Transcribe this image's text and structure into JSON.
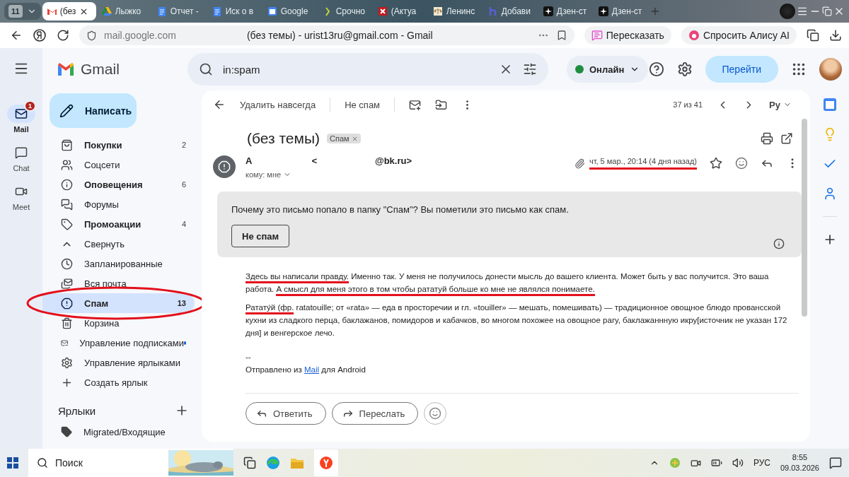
{
  "browser": {
    "tab_count": "11",
    "tabs": [
      {
        "title": "(без",
        "selected": true
      },
      {
        "title": "Лыжко",
        "selected": false
      },
      {
        "title": "Отчет -",
        "selected": false
      },
      {
        "title": "Иск о в",
        "selected": false
      },
      {
        "title": "Google",
        "selected": false
      },
      {
        "title": "Срочно",
        "selected": false
      },
      {
        "title": "(Актуа",
        "selected": false
      },
      {
        "title": "Ленинс",
        "selected": false
      },
      {
        "title": "Добави",
        "selected": false
      },
      {
        "title": "Дзен-ст",
        "selected": false
      },
      {
        "title": "Дзен-ст",
        "selected": false
      }
    ],
    "address": "mail.google.com",
    "page_title": "(без темы) - urist13ru@gmail.com - Gmail",
    "retell_button": "Пересказать",
    "alice_button": "Спросить Алису AI"
  },
  "rail": {
    "items": [
      {
        "label": "Mail",
        "badge": "1",
        "selected": true
      },
      {
        "label": "Chat",
        "selected": false
      },
      {
        "label": "Meet",
        "selected": false
      }
    ]
  },
  "header": {
    "logo": "Gmail",
    "search": "in:spam",
    "status": "Онлайн",
    "go_button": "Перейти"
  },
  "compose": "Написать",
  "sidebar": {
    "items": [
      {
        "label": "Покупки",
        "count": "2",
        "bold": true,
        "selected": false
      },
      {
        "label": "Соцсети",
        "bold": false,
        "selected": false
      },
      {
        "label": "Оповещения",
        "count": "6",
        "bold": true,
        "selected": false
      },
      {
        "label": "Форумы",
        "bold": false,
        "selected": false
      },
      {
        "label": "Промоакции",
        "count": "4",
        "bold": true,
        "selected": false
      },
      {
        "label": "Свернуть",
        "bold": false,
        "selected": false
      },
      {
        "label": "Запланированные",
        "bold": false,
        "selected": false
      },
      {
        "label": "Вся почта",
        "bold": false,
        "selected": false
      },
      {
        "label": "Спам",
        "count": "13",
        "bold": true,
        "selected": true,
        "circled": true
      },
      {
        "label": "Корзина",
        "bold": false,
        "selected": false
      },
      {
        "label": "Управление подписками",
        "bold": false,
        "selected": false,
        "dot": true
      },
      {
        "label": "Управление ярлыками",
        "bold": false,
        "selected": false
      },
      {
        "label": "Создать ярлык",
        "bold": false,
        "selected": false
      }
    ],
    "labels_heading": "Ярлыки",
    "labels": [
      "Migrated/Входящие"
    ]
  },
  "toolbar": {
    "delete_forever": "Удалить навсегда",
    "not_spam": "Не спам",
    "position": "37 из 41",
    "input_tool": "Ру"
  },
  "message": {
    "subject": "(без темы)",
    "label": "Спам",
    "sender_name": "A",
    "sender_open": "<",
    "sender_domain": "@bk.ru>",
    "recipient": "кому: мне",
    "date": "чт, 5 мар., 20:14 (4 дня назад)",
    "date_marked": true,
    "banner": {
      "text": "Почему это письмо попало в папку \"Спам\"? Вы пометили это письмо как спам.",
      "button": "Не спам"
    },
    "paragraphs": [
      {
        "segments": [
          {
            "text": "Здесь вы написали правду.",
            "marked": true
          },
          {
            "text": " Именно так. У меня не получилось донести мысль до вашего клиента. Может быть у вас получится. Это ваша работа. ",
            "marked": false
          },
          {
            "text": "А смысл для меня этого в том чтобы рататуй больше ко мне не являлся понимаете.",
            "marked": true
          }
        ]
      },
      {
        "segments": [
          {
            "text": "Ратату́й (фр.",
            "marked": true
          },
          {
            "text": " ratatouille; от «rata» — еда в просторечии и гл. «touiller» — мешать, помешивать) — традиционное овощное блюдо провансской кухни из сладкого перца, баклажанов, помидоров и кабачков, во многом похожее на овощное рагу, баклажаннную икру[источник не указан 172 дня] и венгерское лечо.",
            "marked": false
          }
        ]
      }
    ],
    "signature": {
      "dash": "--",
      "before": "Отправлено из",
      "link": "Mail",
      "after": "для Android"
    },
    "reply_button": "Ответить",
    "forward_button": "Переслать"
  },
  "taskbar": {
    "search": "Поиск",
    "language": "РУС",
    "time": "8:55",
    "date": "09.03.2026"
  }
}
